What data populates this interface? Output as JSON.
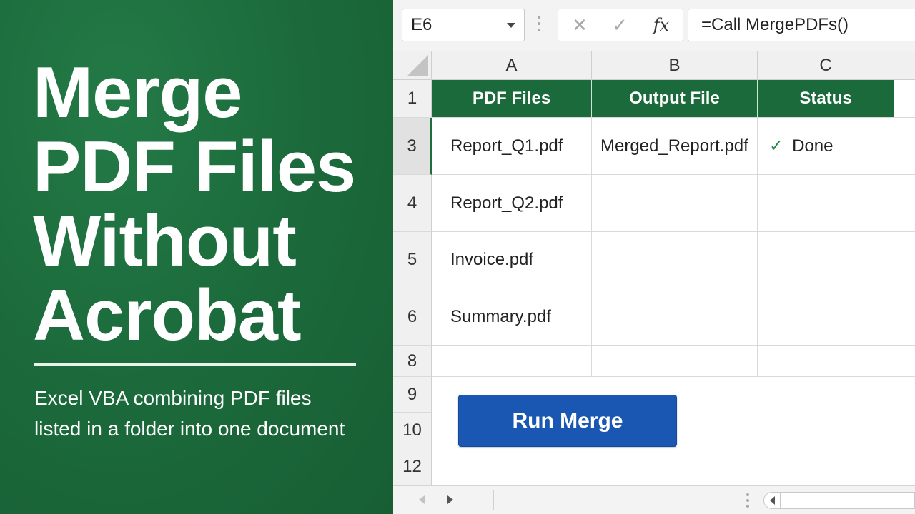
{
  "banner": {
    "title_lines": [
      "Merge",
      "PDF Files",
      "Without",
      "Acrobat"
    ],
    "subtitle_lines": [
      "Excel VBA combining PDF files",
      "listed in a folder into one document"
    ]
  },
  "formula_bar": {
    "name_box": "E6",
    "cancel_icon": "close-icon",
    "enter_icon": "check-icon",
    "fx_label": "fx",
    "formula": "=Call MergePDFs()"
  },
  "sheet": {
    "columns": [
      "A",
      "B",
      "C"
    ],
    "rows": [
      {
        "num": "1",
        "cells": [
          "PDF Files",
          "Output File",
          "Status"
        ],
        "header": true
      },
      {
        "num": "3",
        "cells": [
          "Report_Q1.pdf",
          "Merged_Report.pdf",
          "Done"
        ],
        "active": true
      },
      {
        "num": "4",
        "cells": [
          "Report_Q2.pdf",
          "",
          ""
        ]
      },
      {
        "num": "5",
        "cells": [
          "Invoice.pdf",
          "",
          ""
        ]
      },
      {
        "num": "6",
        "cells": [
          "Summary.pdf",
          "",
          ""
        ]
      },
      {
        "num": "8",
        "cells": [
          "",
          "",
          ""
        ]
      },
      {
        "num": "9",
        "cells": []
      },
      {
        "num": "10",
        "cells": []
      },
      {
        "num": "12",
        "cells": []
      }
    ],
    "status_check_symbol": "✓",
    "colors": {
      "header_green": "#1b6a3b",
      "button_blue": "#1a57b2",
      "check_green": "#1e8a3e"
    }
  },
  "run_button": {
    "label": "Run Merge"
  }
}
